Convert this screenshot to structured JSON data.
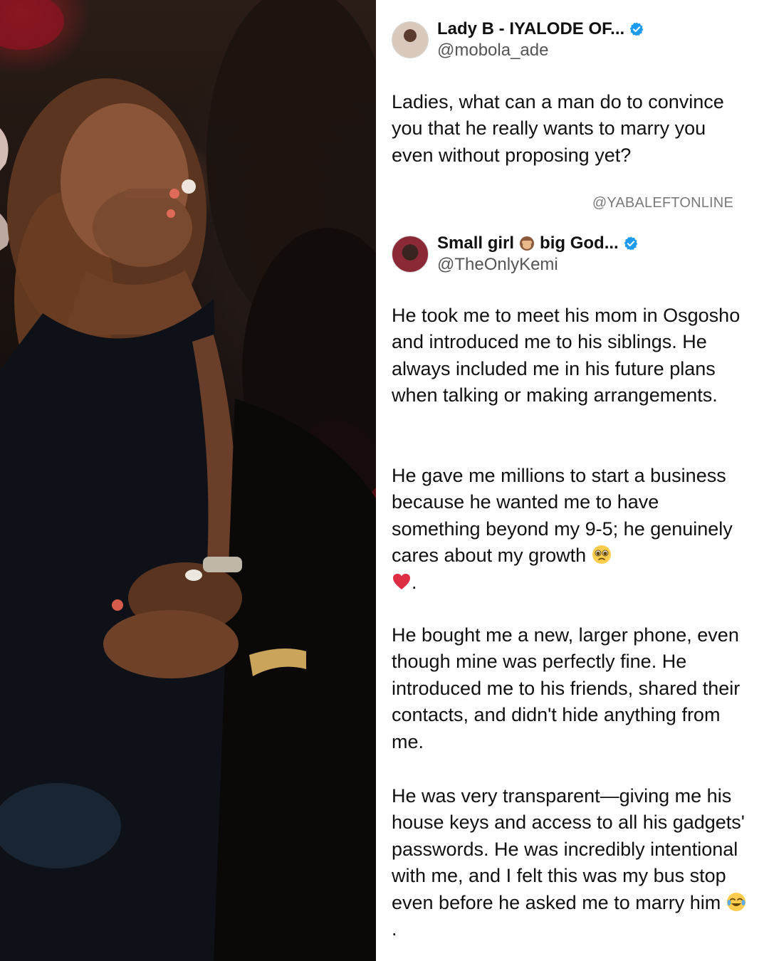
{
  "tweet1": {
    "display_name": "Lady B - IYALODE OF...",
    "handle": "@mobola_ade",
    "verified_badge": "verified-check-icon",
    "text": "Ladies, what can a man do to convince you that he really wants to marry you even without proposing yet?"
  },
  "watermark": "@YABALEFTONLINE",
  "tweet2": {
    "display_name_part1": "Small girl",
    "name_emoji": "see-no-evil-monkey-icon",
    "display_name_part2": "big God...",
    "handle": "@TheOnlyKemi",
    "verified_badge": "verified-check-icon",
    "paragraph1": "He took me to meet his mom in Osgosho and introduced me to his siblings. He always included me in his future plans when talking or making arrangements.",
    "paragraph2": "He gave me millions to start a business because he wanted me to have something beyond my 9-5; he genuinely cares about my growth",
    "paragraph2_emojis": [
      "pleading-face-icon",
      "red-heart-icon"
    ],
    "paragraph2_tail": ".",
    "paragraph3": "He bought me a new, larger phone, even though mine was perfectly fine. He introduced me to his friends, shared their contacts, and didn't hide anything from me.",
    "paragraph4": "He was very transparent—giving me his house keys and access to all his gadgets' passwords. He was incredibly intentional with me, and I felt this was my bus stop even before he asked me to marry him",
    "paragraph4_emoji": "tears-of-joy-icon",
    "paragraph4_tail": "."
  },
  "colors": {
    "verified_blue": "#1d9bf0",
    "text": "#111111",
    "handle": "#555555",
    "watermark": "#7a7a7a"
  }
}
